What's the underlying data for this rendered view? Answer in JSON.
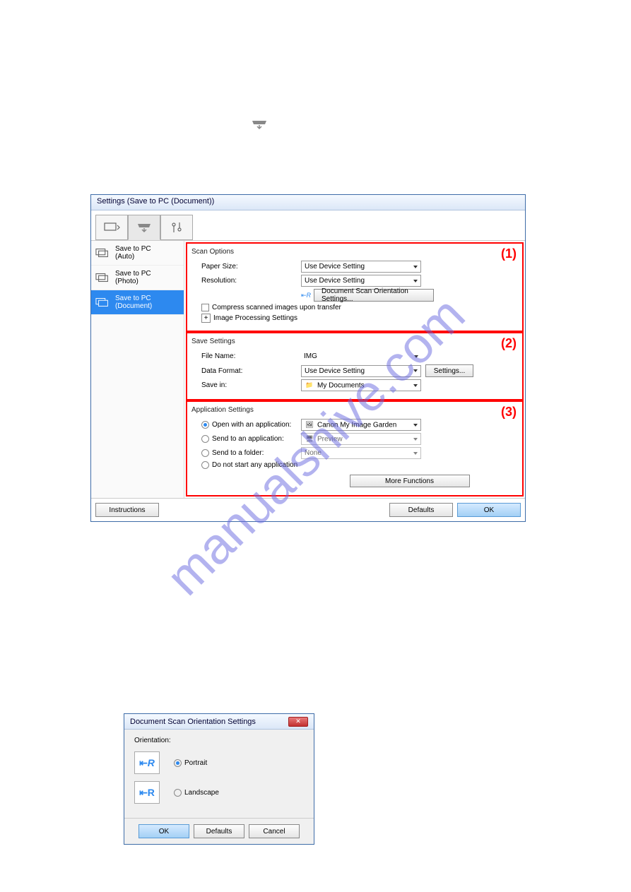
{
  "intro_icon_desc": "(Scanning from the Operation Panel)",
  "win": {
    "title": "Settings (Save to PC (Document))",
    "sidebar": [
      {
        "l1": "Save to PC",
        "l2": "(Auto)"
      },
      {
        "l1": "Save to PC",
        "l2": "(Photo)"
      },
      {
        "l1": "Save to PC",
        "l2": "(Document)"
      }
    ],
    "scan_options": {
      "title": "Scan Options",
      "paper_size_lab": "Paper Size:",
      "paper_size_val": "Use Device Setting",
      "resolution_lab": "Resolution:",
      "resolution_val": "Use Device Setting",
      "orient_btn": "Document Scan Orientation Settings...",
      "compress": "Compress scanned images upon transfer",
      "improc": "Image Processing Settings",
      "anot": "(1)"
    },
    "save_settings": {
      "title": "Save Settings",
      "file_name_lab": "File Name:",
      "file_name_val": "IMG",
      "data_format_lab": "Data Format:",
      "data_format_val": "Use Device Setting",
      "settings_btn": "Settings...",
      "save_in_lab": "Save in:",
      "save_in_val": "My Documents",
      "anot": "(2)"
    },
    "app_settings": {
      "title": "Application Settings",
      "open_lab": "Open with an application:",
      "open_val": "Canon My Image Garden",
      "send_app_lab": "Send to an application:",
      "send_app_val": "Preview",
      "send_folder_lab": "Send to a folder:",
      "send_folder_val": "None",
      "nostart_lab": "Do not start any application",
      "more_fn": "More Functions",
      "anot": "(3)"
    },
    "footer": {
      "instructions": "Instructions",
      "defaults": "Defaults",
      "ok": "OK"
    }
  },
  "dlg": {
    "title": "Document Scan Orientation Settings",
    "orientation_lab": "Orientation:",
    "portrait": "Portrait",
    "landscape": "Landscape",
    "ok": "OK",
    "defaults": "Defaults",
    "cancel": "Cancel"
  },
  "watermark": "manualshive.com"
}
